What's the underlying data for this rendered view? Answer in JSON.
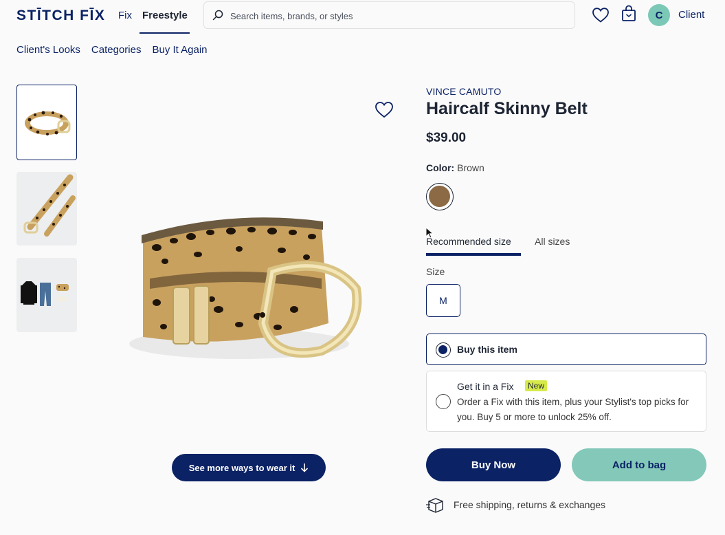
{
  "header": {
    "logo": "STĪTCH FĪX",
    "nav": {
      "fix": "Fix",
      "freestyle": "Freestyle"
    },
    "search_placeholder": "Search items, brands, or styles",
    "avatar_initial": "C",
    "user_name": "Client"
  },
  "subnav": [
    "Client's Looks",
    "Categories",
    "Buy It Again"
  ],
  "gallery": {
    "see_more_label": "See more ways to wear it"
  },
  "product": {
    "brand": "VINCE CAMUTO",
    "name": "Haircalf Skinny Belt",
    "price": "$39.00",
    "color_label": "Color:",
    "color_value": "Brown",
    "swatch_color": "#8c6a45",
    "tabs": {
      "recommended": "Recommended size",
      "all": "All sizes"
    },
    "size_label": "Size",
    "size_value": "M",
    "options": {
      "buy_title": "Buy this item",
      "fix_title": "Get it in a Fix",
      "fix_badge": "New",
      "fix_desc": "Order a Fix with this item, plus your Stylist's top picks for you. Buy 5 or more to unlock 25% off."
    },
    "buy_now": "Buy Now",
    "add_to_bag": "Add to bag",
    "shipping": "Free shipping, returns & exchanges"
  },
  "colors": {
    "navy": "#0b2265",
    "mint": "#83c8b8",
    "badge": "#d7ea4b"
  }
}
